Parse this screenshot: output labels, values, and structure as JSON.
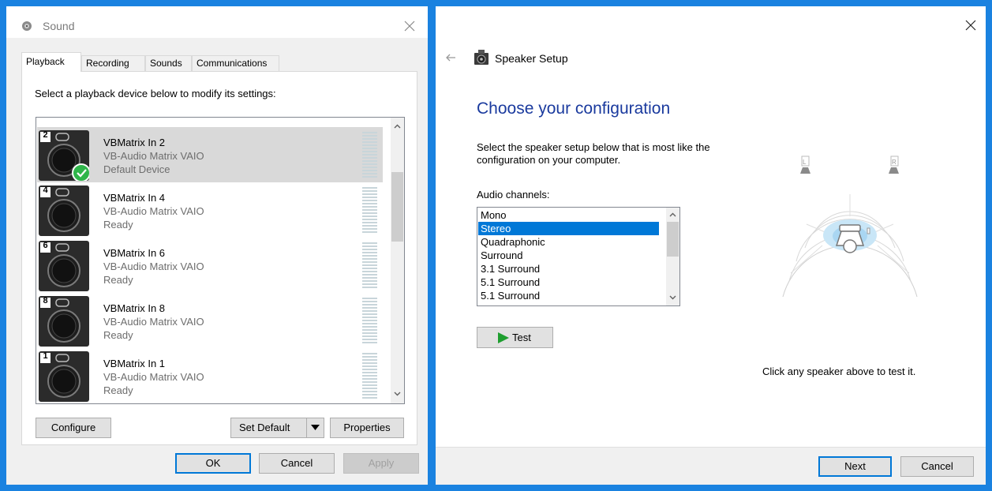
{
  "sound_window": {
    "title": "Sound",
    "tabs": [
      {
        "label": "Playback"
      },
      {
        "label": "Recording"
      },
      {
        "label": "Sounds"
      },
      {
        "label": "Communications"
      }
    ],
    "description": "Select a playback device below to modify its settings:",
    "devices": [
      {
        "badge": "2",
        "name": "VBMatrix In 2",
        "driver": "VB-Audio Matrix VAIO",
        "status": "Default Device",
        "selected": true
      },
      {
        "badge": "4",
        "name": "VBMatrix In 4",
        "driver": "VB-Audio Matrix VAIO",
        "status": "Ready"
      },
      {
        "badge": "6",
        "name": "VBMatrix In 6",
        "driver": "VB-Audio Matrix VAIO",
        "status": "Ready"
      },
      {
        "badge": "8",
        "name": "VBMatrix In 8",
        "driver": "VB-Audio Matrix VAIO",
        "status": "Ready"
      },
      {
        "badge": "1",
        "name": "VBMatrix In 1",
        "driver": "VB-Audio Matrix VAIO",
        "status": "Ready"
      }
    ],
    "buttons": {
      "configure": "Configure",
      "set_default": "Set Default",
      "properties": "Properties",
      "ok": "OK",
      "cancel": "Cancel",
      "apply": "Apply"
    }
  },
  "speaker_setup": {
    "app_title": "Speaker Setup",
    "heading": "Choose your configuration",
    "description": "Select the speaker setup below that is most like the configuration on your computer.",
    "channels_label": "Audio channels:",
    "channels": [
      {
        "label": "Mono"
      },
      {
        "label": "Stereo",
        "selected": true
      },
      {
        "label": "Quadraphonic"
      },
      {
        "label": "Surround"
      },
      {
        "label": "3.1 Surround"
      },
      {
        "label": "5.1 Surround"
      },
      {
        "label": "5.1 Surround"
      }
    ],
    "test_label": "Test",
    "speaker_left": "L",
    "speaker_right": "R",
    "hint": "Click any speaker above to test it.",
    "buttons": {
      "next": "Next",
      "cancel": "Cancel"
    }
  },
  "colors": {
    "desktop": "#1a82e0",
    "selection": "#0078d7",
    "heading": "#1a3a9e",
    "default_check": "#2fb54a",
    "play": "#1e9e2f"
  }
}
